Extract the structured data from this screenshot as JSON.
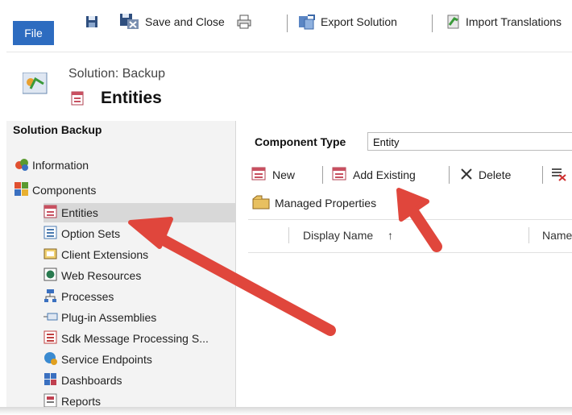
{
  "ribbon": {
    "file_tab": "File",
    "save_close": "Save and Close",
    "export_solution": "Export Solution",
    "import_translations": "Import Translations"
  },
  "header": {
    "solution_title": "Solution: Backup",
    "page_title": "Entities"
  },
  "nav": {
    "title": "Solution Backup",
    "items": [
      {
        "label": "Information",
        "icon": "information-icon"
      },
      {
        "label": "Components",
        "icon": "components-icon"
      },
      {
        "label": "Entities",
        "icon": "entities-icon",
        "selected": true
      },
      {
        "label": "Option Sets",
        "icon": "option-sets-icon"
      },
      {
        "label": "Client Extensions",
        "icon": "client-extensions-icon"
      },
      {
        "label": "Web Resources",
        "icon": "web-resources-icon"
      },
      {
        "label": "Processes",
        "icon": "processes-icon"
      },
      {
        "label": "Plug-in Assemblies",
        "icon": "plugin-assemblies-icon"
      },
      {
        "label": "Sdk Message Processing S...",
        "icon": "sdk-message-icon"
      },
      {
        "label": "Service Endpoints",
        "icon": "service-endpoints-icon"
      },
      {
        "label": "Dashboards",
        "icon": "dashboards-icon"
      },
      {
        "label": "Reports",
        "icon": "reports-icon"
      }
    ]
  },
  "main": {
    "component_type_label": "Component Type",
    "component_type_value": "Entity",
    "toolbar": {
      "new_label": "New",
      "add_existing_label": "Add Existing",
      "delete_label": "Delete"
    },
    "managed_properties_label": "Managed Properties",
    "grid": {
      "columns": [
        "Display Name",
        "Name"
      ],
      "sort_indicator": "↑"
    }
  },
  "colors": {
    "file_tab": "#2d6cc0",
    "annotation_arrow": "#e0463c",
    "nav_bg": "#f3f3f3",
    "nav_selected": "#d8d8d8"
  }
}
